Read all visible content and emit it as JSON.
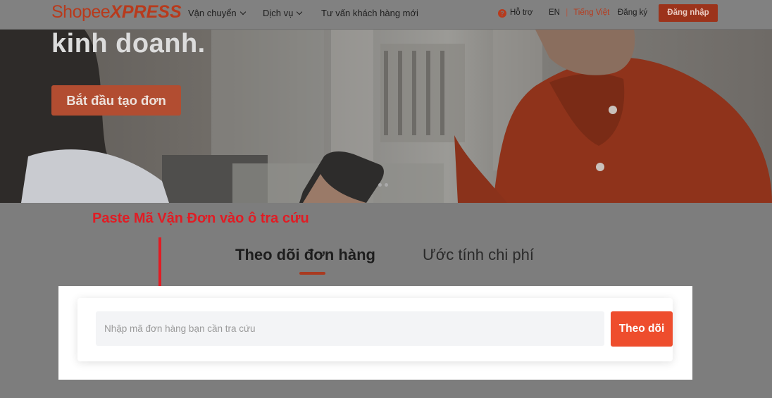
{
  "header": {
    "logo_shopee": "Shopee",
    "logo_xpress": "XPRESS",
    "nav": [
      "Vận chuyển",
      "Dịch vụ",
      "Tư vấn khách hàng mới"
    ],
    "support": "Hỗ trợ",
    "lang_en": "EN",
    "lang_sep": "|",
    "lang_vi": "Tiếng Việt",
    "register": "Đăng ký",
    "login": "Đăng nhập"
  },
  "hero": {
    "headline": "kinh doanh.",
    "cta": "Bắt đầu tạo đơn"
  },
  "annotation": {
    "text": "Paste Mã Vận Đơn vào ô tra cứu",
    "color": "#e11c24"
  },
  "tabs": {
    "track": "Theo dõi đơn hàng",
    "estimate": "Ước tính chi phí",
    "active": "track"
  },
  "tracking": {
    "placeholder": "Nhập mã đơn hàng bạn cần tra cứu",
    "value": "",
    "button": "Theo dõi"
  },
  "colors": {
    "brand": "#ee4d2d",
    "brand_dimmed": "#9c331b",
    "overlay": "#7d7d7d"
  },
  "icons": {
    "help": "question-circle-icon",
    "dropdown": "chevron-down-icon"
  }
}
